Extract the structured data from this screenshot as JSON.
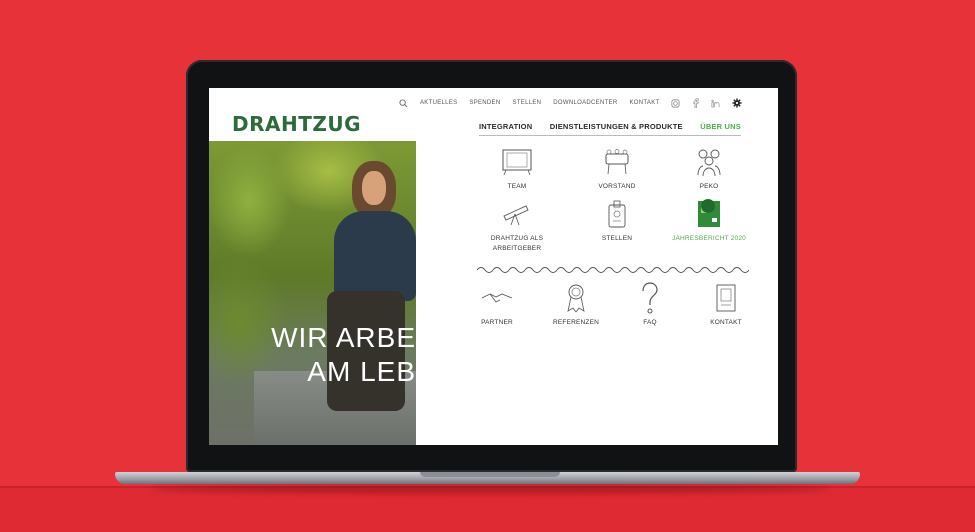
{
  "site": {
    "logo": "DRAHTZUG"
  },
  "topnav": {
    "items": [
      "AKTUELLES",
      "SPENDEN",
      "STELLEN",
      "DOWNLOADCENTER",
      "KONTAKT"
    ],
    "icons": [
      "search-icon",
      "instagram-icon",
      "facebook-icon",
      "linkedin-icon",
      "settings-icon"
    ]
  },
  "mainnav": {
    "items": [
      "INTEGRATION",
      "DIENSTLEISTUNGEN & PRODUKTE",
      "ÜBER UNS"
    ],
    "active": "ÜBER UNS"
  },
  "hero": {
    "line1": "WIR ARBE",
    "line2": "AM LEB"
  },
  "menu": {
    "row1": [
      {
        "label": "TEAM",
        "icon": "team-icon"
      },
      {
        "label": "VORSTAND",
        "icon": "board-icon"
      },
      {
        "label": "PEKO",
        "icon": "people-icon"
      }
    ],
    "row2": [
      {
        "label": "DRAHTZUG ALS",
        "label2": "ARBEITGEBER",
        "icon": "telescope-icon"
      },
      {
        "label": "STELLEN",
        "icon": "badge-icon"
      },
      {
        "label": "JAHRESBERICHT 2020",
        "icon": "report-icon"
      }
    ],
    "row3": [
      {
        "label": "PARTNER",
        "icon": "handshake-icon"
      },
      {
        "label": "REFERENZEN",
        "icon": "award-icon"
      },
      {
        "label": "FAQ",
        "icon": "question-icon"
      },
      {
        "label": "KONTAKT",
        "icon": "contact-icon"
      }
    ]
  },
  "colors": {
    "background": "#e8323a",
    "brand_green": "#2d6b3a",
    "accent_green": "#4fae4a"
  }
}
